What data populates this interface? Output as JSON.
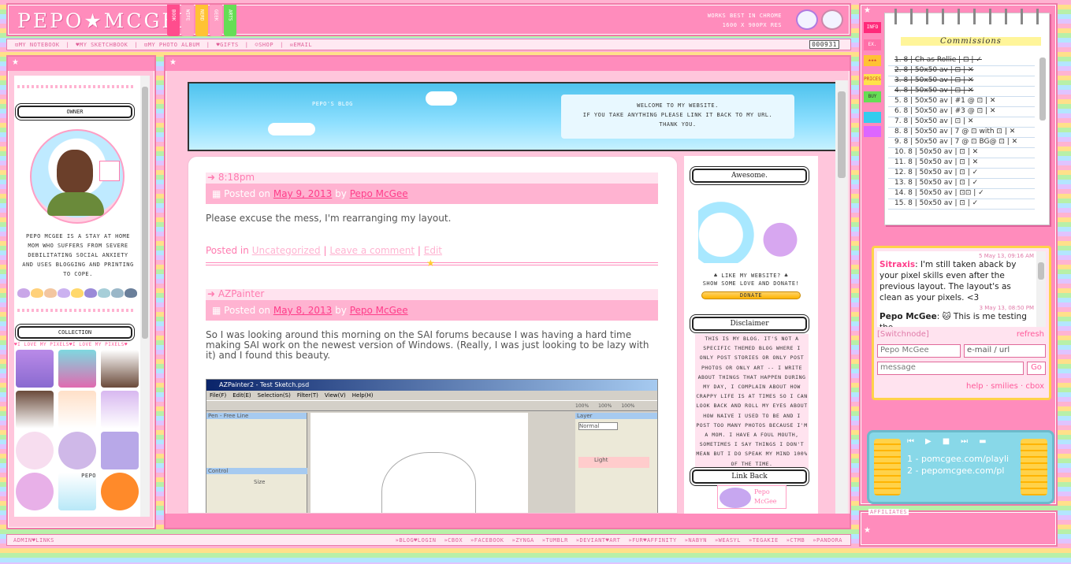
{
  "header": {
    "logo": "PEPO★MCGEE",
    "tabs": [
      "BOOK",
      "WIFE",
      "NERD",
      "GEEK",
      "ARTS"
    ],
    "works_line1": "WORKS BEST IN CHROME",
    "works_line2": "1600 X 900PX RES"
  },
  "nav": {
    "items": [
      "⊡MY NOTEBOOK",
      "|",
      "♥MY SKETCHBOOK",
      "|",
      "⊡MY PHOTO ALBUM",
      "|",
      "♥GIFTS",
      "|",
      "☺SHOP",
      "|",
      "✉EMAIL"
    ],
    "counter": "000931"
  },
  "left": {
    "owner_title": "OWNER",
    "bio": "PEPO MCGEE IS A STAY AT HOME MOM WHO SUFFERS FROM SEVERE DEBILITATING SOCIAL ANXIETY AND USES BLOGGING AND PRINTING TO COPE.",
    "collection_title": "COLLECTION",
    "i_love": "♥I LOVE MY PIXELS♥I LOVE MY PIXELS♥",
    "pepo_tag": "PEPO"
  },
  "banner": {
    "blog_label": "PEPO'S BLOG",
    "welcome1": "WELCOME TO MY WEBSITE.",
    "welcome2": "IF YOU TAKE ANYTHING PLEASE LINK IT BACK TO MY URL.",
    "welcome3": "THANK YOU."
  },
  "posts": [
    {
      "title": "➜ 8:18pm",
      "posted_on": "Posted on",
      "date": "May 9, 2013",
      "by": "by",
      "author": "Pepo McGee",
      "body": "Please excuse the mess, I'm rearranging my layout.",
      "posted_in": "Posted in",
      "category": "Uncategorized",
      "sep": "|",
      "leave_comment": "Leave a comment",
      "edit": "Edit"
    },
    {
      "title": "➜ AZPainter",
      "posted_on": "Posted on",
      "date": "May 8, 2013",
      "by": "by",
      "author": "Pepo McGee",
      "body": "So I was looking around this morning on the SAI forums because I was having a hard time making SAI work on the newest version of Windows. (Really, I was just looking to be lazy with it) and I found this beauty."
    }
  ],
  "screenshot": {
    "title": "AZPainter2 - Test Sketch.psd",
    "menu": [
      "File(F)",
      "Edit(E)",
      "Selection(S)",
      "Filter(T)",
      "View(V)",
      "Help(H)"
    ],
    "panel_label": "Pen - Free Line",
    "layer_label": "Layer",
    "control_label": "Control",
    "size_label": "Size",
    "normal": "Normal",
    "light": "Light",
    "zoom1": "100%",
    "zoom2": "100%",
    "zoom3": "100%"
  },
  "sidebar": {
    "awesome_title": "Awesome.",
    "like1": "♣ LIKE MY WEBSITE? ♣",
    "like2": "SHOW SOME LOVE AND DONATE!",
    "donate": "DONATE",
    "disclaimer_title": "Disclaimer",
    "disclaimer_text": "THIS IS MY BLOG. IT'S NOT A SPECIFIC THEMED BLOG WHERE I ONLY POST STORIES OR ONLY POST PHOTOS OR ONLY ART -- I WRITE ABOUT THINGS THAT HAPPEN DURING MY DAY, I COMPLAIN ABOUT HOW CRAPPY LIFE IS AT TIMES SO I CAN LOOK BACK AND ROLL MY EYES ABOUT HOW NAIVE I USED TO BE AND I POST TOO MANY PHOTOS BECAUSE I'M A MOM. I HAVE A FOUL MOUTH, SOMETIMES I SAY THINGS I DON'T MEAN BUT I DO SPEAK MY MIND 100% OF THE TIME.",
    "linkback_title": "Link Back",
    "linkback_badge": "Pepo McGee"
  },
  "right": {
    "tabs": [
      "INFO",
      "EX.",
      "★★★",
      "PRICES",
      "BUY"
    ],
    "commissions_title": "Commissions",
    "commissions": [
      "1. 8 | Ch as Rollie | ⊡ | ✓",
      "2. 8 | 50x50 av | ⊡ | ✕",
      "3. 8 | 50x50 av | ⊡ | ✕",
      "4. 8 | 50x50 av | ⊡ | ✕",
      "5. 8 | 50x50 av | #1 @ ⊡ | ✕",
      "6. 8 | 50x50 av | #3 @ ⊡ | ✕",
      "7. 8 | 50x50 av | ⊡ | ✕",
      "8. 8 | 50x50 av | 7 @ ⊡ with ⊡ | ✕",
      "9. 8 | 50x50 av | 7 @ ⊡ BG@ ⊡ | ✕",
      "10. 8 | 50x50 av | ⊡ | ✕",
      "11. 8 | 50x50 av | ⊡ | ✕",
      "12. 8 | 50x50 av | ⊡ | ✓",
      "13. 8 | 50x50 av | ⊡ | ✓",
      "14. 8 | 50x50 av | ⊡⊡ | ✓",
      "15. 8 | 50x50 av | ⊡ | ✓"
    ],
    "cbox": {
      "msg1_time": "5 May 13, 09:16 AM",
      "msg1_name": "Sitraxis",
      "msg1_text": ": I'm still taken aback by your pixel skills even after the previous layout. The layout's as clean as your pixels. <3",
      "msg2_time": "3 May 13, 08:50 PM",
      "msg2_name": "Pepo McGee",
      "msg2_text": ": 🐱 This is me testing the",
      "switch": "[Switchnode]",
      "refresh": "refresh",
      "name_value": "Pepo McGee",
      "email_placeholder": "e-mail / url",
      "message_placeholder": "message",
      "go": "Go",
      "help": "help",
      "smilies": "smilies",
      "cbox_link": "cbox",
      "dot": "·"
    },
    "player": {
      "track1": "1 - pomcgee.com/playli",
      "track2": "2 - pepomcgee.com/pl"
    },
    "affiliates": "AFFILIATES"
  },
  "footer": {
    "left": "ADMIN♥LINKS",
    "links": [
      "»BLOG♥LOGIN",
      "»CBOX",
      "»FACEBOOK",
      "»ZYNGA",
      "»TUMBLR",
      "»DEVIANT♥ART",
      "»FUR♥AFFINITY",
      "»NABYN",
      "»WEASYL",
      "»TEGAKIE",
      "»CTMB",
      "»PANDORA"
    ]
  },
  "colors": {
    "pink": "#ff8cbc",
    "light_pink": "#ffc6dc",
    "accent": "#ff3d8a"
  }
}
